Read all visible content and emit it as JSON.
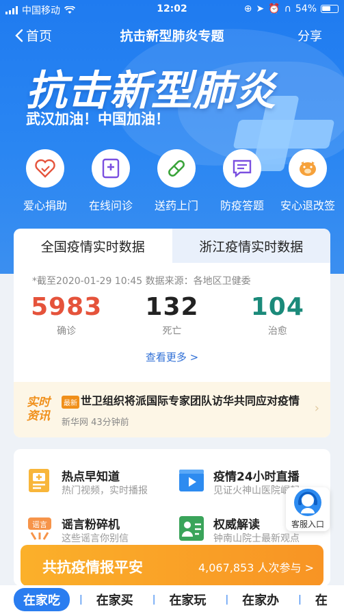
{
  "status": {
    "carrier": "中国移动",
    "time": "12:02",
    "battery": "54%"
  },
  "nav": {
    "back_label": "首页",
    "title": "抗击新型肺炎专题",
    "share_label": "分享"
  },
  "hero": {
    "headline": "抗击新型肺炎",
    "subline": "武汉加油！中国加油！"
  },
  "quick_actions": [
    {
      "label": "爱心捐助",
      "icon": "heart-icon"
    },
    {
      "label": "在线问诊",
      "icon": "medical-record-icon"
    },
    {
      "label": "送药上门",
      "icon": "pill-icon"
    },
    {
      "label": "防疫答题",
      "icon": "chat-list-icon"
    },
    {
      "label": "安心退改签",
      "icon": "pig-icon"
    }
  ],
  "stats_card": {
    "tabs": [
      "全国疫情实时数据",
      "浙江疫情实时数据"
    ],
    "update_text": "*截至2020-01-29 10:45 数据来源：各地区卫健委",
    "stats": [
      {
        "value": "5983",
        "label": "确诊",
        "color": "#e5533b"
      },
      {
        "value": "132",
        "label": "死亡",
        "color": "#222222"
      },
      {
        "value": "104",
        "label": "治愈",
        "color": "#1b8a7a"
      }
    ],
    "more_label": "查看更多 >"
  },
  "news": {
    "logo_line1": "实时",
    "logo_line2": "资讯",
    "tag": "最新",
    "title": "世卫组织将派国际专家团队访华共同应对疫情",
    "source": "新华网 43分钟前"
  },
  "services": [
    {
      "title": "热点早知道",
      "subtitle": "热门视频，实时播报",
      "icon": "news-icon"
    },
    {
      "title": "疫情24小时直播",
      "subtitle": "见证火神山医院崛起",
      "icon": "video-icon"
    },
    {
      "title": "谣言粉碎机",
      "subtitle": "这些谣言你别信",
      "icon": "rumor-icon"
    },
    {
      "title": "权威解读",
      "subtitle": "钟南山院士最新观点",
      "icon": "doctor-icon"
    }
  ],
  "customer_service": {
    "label": "客服入口"
  },
  "banner": {
    "title": "共抗疫情报平安",
    "count": "4,067,853 人次参与 >"
  },
  "bottom_tabs": [
    "在家吃",
    "在家买",
    "在家玩",
    "在家办",
    "在"
  ]
}
